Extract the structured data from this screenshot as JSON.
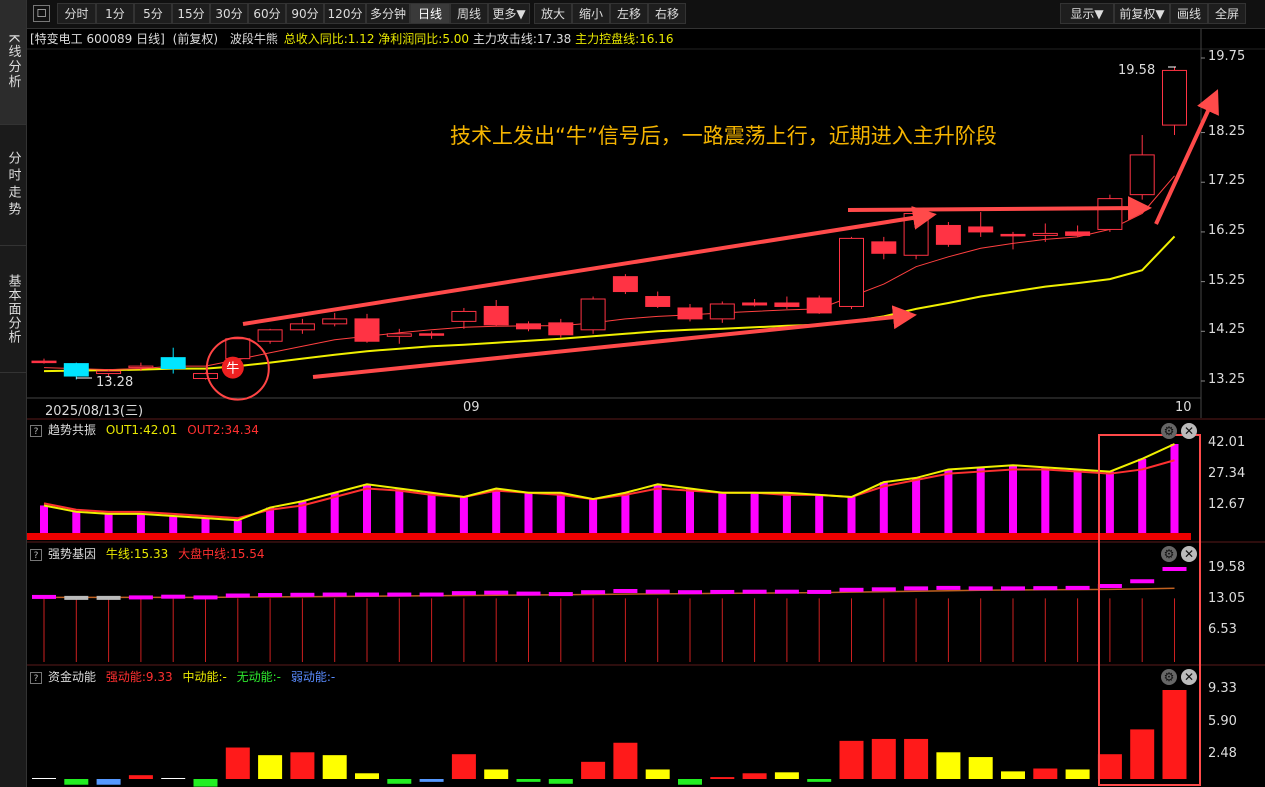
{
  "sidebar": {
    "tabs": [
      {
        "label": "K线分析",
        "active": true
      },
      {
        "label": "分时走势",
        "active": false
      },
      {
        "label": "基本面分析",
        "active": false
      }
    ]
  },
  "toolbar": {
    "left": [
      {
        "label": "分时",
        "active": false
      },
      {
        "label": "1分",
        "active": false
      },
      {
        "label": "5分",
        "active": false
      },
      {
        "label": "15分",
        "active": false
      },
      {
        "label": "30分",
        "active": false
      },
      {
        "label": "60分",
        "active": false
      },
      {
        "label": "90分",
        "active": false
      },
      {
        "label": "120分",
        "active": false
      },
      {
        "label": "多分钟",
        "active": false
      },
      {
        "label": "日线",
        "active": true
      },
      {
        "label": "周线",
        "active": false
      },
      {
        "label": "更多▼",
        "active": false
      },
      {
        "label": "放大",
        "active": false
      },
      {
        "label": "缩小",
        "active": false
      },
      {
        "label": "左移",
        "active": false
      },
      {
        "label": "右移",
        "active": false
      }
    ],
    "right": [
      {
        "label": "显示▼"
      },
      {
        "label": "前复权▼"
      },
      {
        "label": "画线"
      },
      {
        "label": "全屏"
      }
    ]
  },
  "info": {
    "stock": "[特变电工 600089 日线]",
    "adjust": "(前复权)",
    "indicator": "波段牛熊",
    "rev_label": "总收入同比:1.12",
    "profit_label": "净利润同比:5.00",
    "attack_label": "主力攻击线:17.38",
    "control_label": "主力控盘线:16.16"
  },
  "main_chart": {
    "price_axis": [
      "19.75",
      "18.25",
      "17.25",
      "16.25",
      "15.25",
      "14.25",
      "13.25"
    ],
    "high_label": "19.58",
    "low_label": "13.28",
    "bull_signal": "牛",
    "annotation": "技术上发出“牛”信号后，一路震荡上行，近期进入主升阶段",
    "dates": [
      "2025/08/13(三)",
      "09",
      "10"
    ]
  },
  "chart_data": [
    {
      "type": "candlestick",
      "title": "特变电工 600089 日线",
      "ylim": [
        13.25,
        19.75
      ],
      "candles": [
        {
          "o": 13.65,
          "h": 13.7,
          "l": 13.6,
          "c": 13.62
        },
        {
          "o": 13.6,
          "h": 13.62,
          "l": 13.28,
          "c": 13.35
        },
        {
          "o": 13.4,
          "h": 13.48,
          "l": 13.32,
          "c": 13.45
        },
        {
          "o": 13.52,
          "h": 13.62,
          "l": 13.45,
          "c": 13.55
        },
        {
          "o": 13.5,
          "h": 13.92,
          "l": 13.4,
          "c": 13.72
        },
        {
          "o": 13.3,
          "h": 13.42,
          "l": 13.28,
          "c": 13.4
        },
        {
          "o": 13.7,
          "h": 14.12,
          "l": 13.66,
          "c": 14.1
        },
        {
          "o": 14.05,
          "h": 14.3,
          "l": 14.0,
          "c": 14.28
        },
        {
          "o": 14.28,
          "h": 14.5,
          "l": 14.2,
          "c": 14.4
        },
        {
          "o": 14.4,
          "h": 14.62,
          "l": 14.35,
          "c": 14.5
        },
        {
          "o": 14.5,
          "h": 14.6,
          "l": 14.02,
          "c": 14.05
        },
        {
          "o": 14.15,
          "h": 14.3,
          "l": 14.0,
          "c": 14.2
        },
        {
          "o": 14.2,
          "h": 14.25,
          "l": 14.1,
          "c": 14.18
        },
        {
          "o": 14.45,
          "h": 14.72,
          "l": 14.3,
          "c": 14.65
        },
        {
          "o": 14.75,
          "h": 14.88,
          "l": 14.35,
          "c": 14.38
        },
        {
          "o": 14.4,
          "h": 14.45,
          "l": 14.25,
          "c": 14.3
        },
        {
          "o": 14.42,
          "h": 14.5,
          "l": 14.12,
          "c": 14.18
        },
        {
          "o": 14.28,
          "h": 14.95,
          "l": 14.2,
          "c": 14.9
        },
        {
          "o": 15.35,
          "h": 15.4,
          "l": 15.0,
          "c": 15.05
        },
        {
          "o": 14.95,
          "h": 15.05,
          "l": 14.72,
          "c": 14.75
        },
        {
          "o": 14.72,
          "h": 14.8,
          "l": 14.45,
          "c": 14.5
        },
        {
          "o": 14.5,
          "h": 14.85,
          "l": 14.42,
          "c": 14.8
        },
        {
          "o": 14.82,
          "h": 14.9,
          "l": 14.75,
          "c": 14.78
        },
        {
          "o": 14.82,
          "h": 14.95,
          "l": 14.7,
          "c": 14.75
        },
        {
          "o": 14.92,
          "h": 14.97,
          "l": 14.6,
          "c": 14.62
        },
        {
          "o": 14.75,
          "h": 16.15,
          "l": 14.7,
          "c": 16.12
        },
        {
          "o": 16.05,
          "h": 16.15,
          "l": 15.7,
          "c": 15.82
        },
        {
          "o": 15.78,
          "h": 16.7,
          "l": 15.7,
          "c": 16.62
        },
        {
          "o": 16.38,
          "h": 16.45,
          "l": 15.95,
          "c": 16.0
        },
        {
          "o": 16.35,
          "h": 16.65,
          "l": 16.15,
          "c": 16.25
        },
        {
          "o": 16.2,
          "h": 16.25,
          "l": 15.9,
          "c": 16.18
        },
        {
          "o": 16.18,
          "h": 16.42,
          "l": 16.05,
          "c": 16.22
        },
        {
          "o": 16.25,
          "h": 16.38,
          "l": 16.15,
          "c": 16.18
        },
        {
          "o": 16.3,
          "h": 17.0,
          "l": 16.25,
          "c": 16.92
        },
        {
          "o": 17.0,
          "h": 18.2,
          "l": 16.9,
          "c": 17.8
        },
        {
          "o": 18.4,
          "h": 19.58,
          "l": 18.2,
          "c": 19.5
        }
      ],
      "ma_red": [
        13.52,
        13.5,
        13.48,
        13.5,
        13.55,
        13.55,
        13.68,
        13.82,
        13.95,
        14.08,
        14.15,
        14.22,
        14.28,
        14.33,
        14.35,
        14.36,
        14.36,
        14.42,
        14.5,
        14.55,
        14.58,
        14.62,
        14.65,
        14.68,
        14.7,
        14.95,
        15.2,
        15.55,
        15.75,
        15.92,
        16.02,
        16.1,
        16.15,
        16.3,
        16.62,
        17.38
      ],
      "ma_yellow": [
        13.45,
        13.46,
        13.47,
        13.48,
        13.5,
        13.5,
        13.55,
        13.62,
        13.7,
        13.78,
        13.85,
        13.9,
        13.95,
        13.98,
        14.02,
        14.06,
        14.1,
        14.15,
        14.2,
        14.25,
        14.28,
        14.3,
        14.33,
        14.36,
        14.38,
        14.45,
        14.55,
        14.7,
        14.82,
        14.95,
        15.05,
        15.15,
        15.22,
        15.3,
        15.48,
        16.16
      ]
    },
    {
      "type": "bar",
      "title": "趋势共振",
      "ylim": [
        0,
        42.01
      ],
      "axis": [
        "42.01",
        "27.34",
        "12.67"
      ],
      "series": [
        {
          "name": "OUT1",
          "value_label": "OUT1:42.01",
          "values": [
            13,
            10,
            9,
            9,
            8,
            7,
            6,
            12,
            15,
            19,
            23,
            21,
            19,
            17,
            21,
            19,
            19,
            16,
            19,
            23,
            21,
            19,
            19,
            19,
            18,
            17,
            24,
            26,
            30,
            31,
            32,
            31,
            30,
            29,
            35,
            42.01
          ]
        },
        {
          "name": "OUT2",
          "value_label": "OUT2:34.34",
          "values": [
            14,
            11,
            10,
            10,
            9,
            8,
            7,
            11,
            13,
            17,
            21,
            20,
            18,
            17,
            20,
            19,
            18,
            16,
            18,
            21,
            20,
            19,
            19,
            18,
            18,
            17,
            22,
            25,
            28,
            29,
            30,
            30,
            29,
            28,
            30,
            34.34
          ]
        }
      ]
    },
    {
      "type": "bar",
      "title": "强势基因",
      "ylim": [
        0,
        19.58
      ],
      "axis": [
        "19.58",
        "13.05",
        "6.53"
      ],
      "series": [
        {
          "name": "牛线",
          "value_label": "牛线:15.33",
          "values": [
            13.7,
            13.5,
            13.5,
            13.6,
            13.75,
            13.6,
            14.0,
            14.1,
            14.15,
            14.2,
            14.2,
            14.2,
            14.2,
            14.5,
            14.6,
            14.4,
            14.3,
            14.7,
            14.95,
            14.8,
            14.7,
            14.75,
            14.8,
            14.8,
            14.75,
            15.2,
            15.3,
            15.5,
            15.6,
            15.5,
            15.5,
            15.55,
            15.6,
            16.0,
            17.0,
            19.58
          ]
        },
        {
          "name": "大盘中线",
          "value_label": "大盘中线:15.54",
          "values": [
            13.6,
            13.6,
            13.6,
            13.6,
            13.6,
            13.6,
            13.65,
            13.7,
            13.75,
            13.8,
            13.85,
            13.9,
            13.95,
            14.0,
            14.05,
            14.1,
            14.15,
            14.2,
            14.3,
            14.35,
            14.4,
            14.45,
            14.5,
            14.55,
            14.6,
            14.7,
            14.8,
            14.9,
            15.0,
            15.1,
            15.15,
            15.2,
            15.25,
            15.3,
            15.4,
            15.54
          ]
        }
      ]
    },
    {
      "type": "bar",
      "title": "资金动能",
      "ylim": [
        0,
        9.33
      ],
      "axis": [
        "9.33",
        "5.90",
        "2.48"
      ],
      "series": [
        {
          "name": "强动能",
          "value_label": "强动能:9.33"
        },
        {
          "name": "中动能",
          "value_label": "中动能:-"
        },
        {
          "name": "无动能",
          "value_label": "无动能:-"
        },
        {
          "name": "弱动能",
          "value_label": "弱动能:-"
        }
      ],
      "bars": [
        {
          "v": 0.1,
          "c": "#ffffff"
        },
        {
          "v": -0.6,
          "c": "#22ee22"
        },
        {
          "v": -0.6,
          "c": "#5599ff"
        },
        {
          "v": 0.4,
          "c": "#ff1a1a"
        },
        {
          "v": 0.1,
          "c": "#ffffff"
        },
        {
          "v": -0.8,
          "c": "#22ee22"
        },
        {
          "v": 3.3,
          "c": "#ff1a1a"
        },
        {
          "v": 2.5,
          "c": "#ffff00"
        },
        {
          "v": 2.8,
          "c": "#ff1a1a"
        },
        {
          "v": 2.5,
          "c": "#ffff00"
        },
        {
          "v": 0.6,
          "c": "#ffff00"
        },
        {
          "v": -0.5,
          "c": "#22ee22"
        },
        {
          "v": -0.3,
          "c": "#5599ff"
        },
        {
          "v": 2.6,
          "c": "#ff1a1a"
        },
        {
          "v": 1.0,
          "c": "#ffff00"
        },
        {
          "v": -0.3,
          "c": "#22ee22"
        },
        {
          "v": -0.5,
          "c": "#22ee22"
        },
        {
          "v": 1.8,
          "c": "#ff1a1a"
        },
        {
          "v": 3.8,
          "c": "#ff1a1a"
        },
        {
          "v": 1.0,
          "c": "#ffff00"
        },
        {
          "v": -0.6,
          "c": "#22ee22"
        },
        {
          "v": 0.2,
          "c": "#ff1a1a"
        },
        {
          "v": 0.6,
          "c": "#ff1a1a"
        },
        {
          "v": 0.7,
          "c": "#ffff00"
        },
        {
          "v": -0.3,
          "c": "#22ee22"
        },
        {
          "v": 4.0,
          "c": "#ff1a1a"
        },
        {
          "v": 4.2,
          "c": "#ff1a1a"
        },
        {
          "v": 4.2,
          "c": "#ff1a1a"
        },
        {
          "v": 2.8,
          "c": "#ffff00"
        },
        {
          "v": 2.3,
          "c": "#ffff00"
        },
        {
          "v": 0.8,
          "c": "#ffff00"
        },
        {
          "v": 1.1,
          "c": "#ff1a1a"
        },
        {
          "v": 1.0,
          "c": "#ffff00"
        },
        {
          "v": 2.6,
          "c": "#ff1a1a"
        },
        {
          "v": 5.2,
          "c": "#ff1a1a"
        },
        {
          "v": 9.33,
          "c": "#ff1a1a"
        }
      ]
    }
  ],
  "colors": {
    "up": "#ff3344",
    "down": "#00e5ff",
    "ma_yellow": "#f0f000",
    "ma_red": "#ff4040",
    "magenta": "#ff00ff",
    "annotation": "#f5b400",
    "arrow": "#ff4a4a"
  },
  "icons": {
    "main_menu": "grid-icon",
    "gear": "gear-icon",
    "close": "close-icon",
    "help": "question-icon"
  }
}
